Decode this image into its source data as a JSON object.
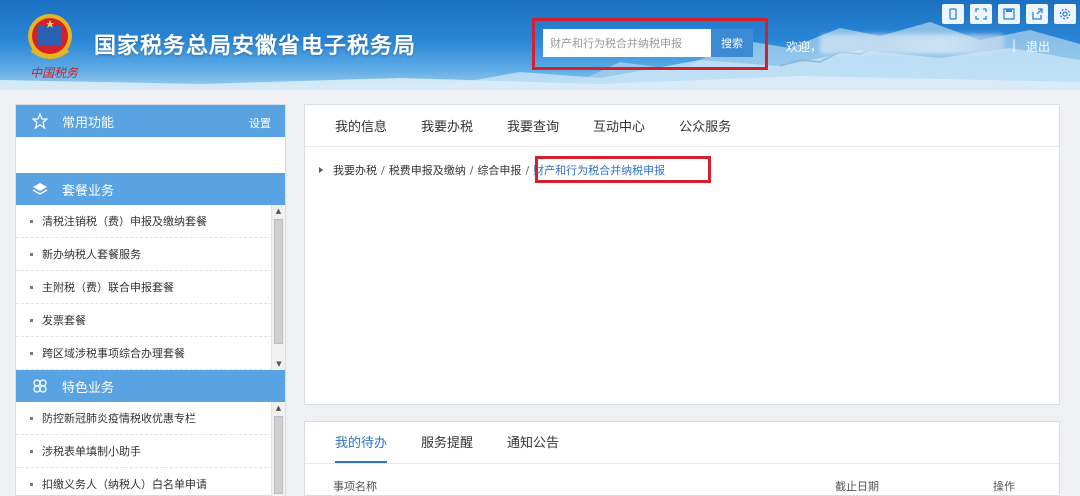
{
  "header": {
    "title": "国家税务总局安徽省电子税务局",
    "emblem_caption": "中国税务",
    "search": {
      "placeholder": "财产和行为税合并纳税申报",
      "button_label": "搜索"
    },
    "welcome": "欢迎，",
    "separator": "|",
    "logout": "退出",
    "tool_icons": [
      "tablet-icon",
      "fullscreen-icon",
      "save-icon",
      "share-icon",
      "settings-gear-icon"
    ]
  },
  "sidebar": {
    "common": {
      "title": "常用功能",
      "settings_label": "设置"
    },
    "package": {
      "title": "套餐业务",
      "items": [
        "清税注销税（费）申报及缴纳套餐",
        "新办纳税人套餐服务",
        "主附税（费）联合申报套餐",
        "发票套餐",
        "跨区域涉税事项综合办理套餐"
      ]
    },
    "feature": {
      "title": "特色业务",
      "items": [
        "防控新冠肺炎疫情税收优惠专栏",
        "涉税表单填制小助手",
        "扣缴义务人（纳税人）白名单申请"
      ]
    }
  },
  "main": {
    "tabs": [
      "我的信息",
      "我要办税",
      "我要查询",
      "互动中心",
      "公众服务"
    ],
    "breadcrumb": [
      "我要办税",
      "税费申报及缴纳",
      "综合申报",
      "财产和行为税合并纳税申报"
    ],
    "breadcrumb_separator": "/"
  },
  "todo": {
    "tabs": [
      "我的待办",
      "服务提醒",
      "通知公告"
    ],
    "columns": [
      "事项名称",
      "截止日期",
      "操作"
    ]
  },
  "colors": {
    "brand_blue": "#2a86d6",
    "sidebar_header": "#5aa3e2",
    "highlight_red": "#d3202c",
    "active_link": "#2e73c9"
  }
}
